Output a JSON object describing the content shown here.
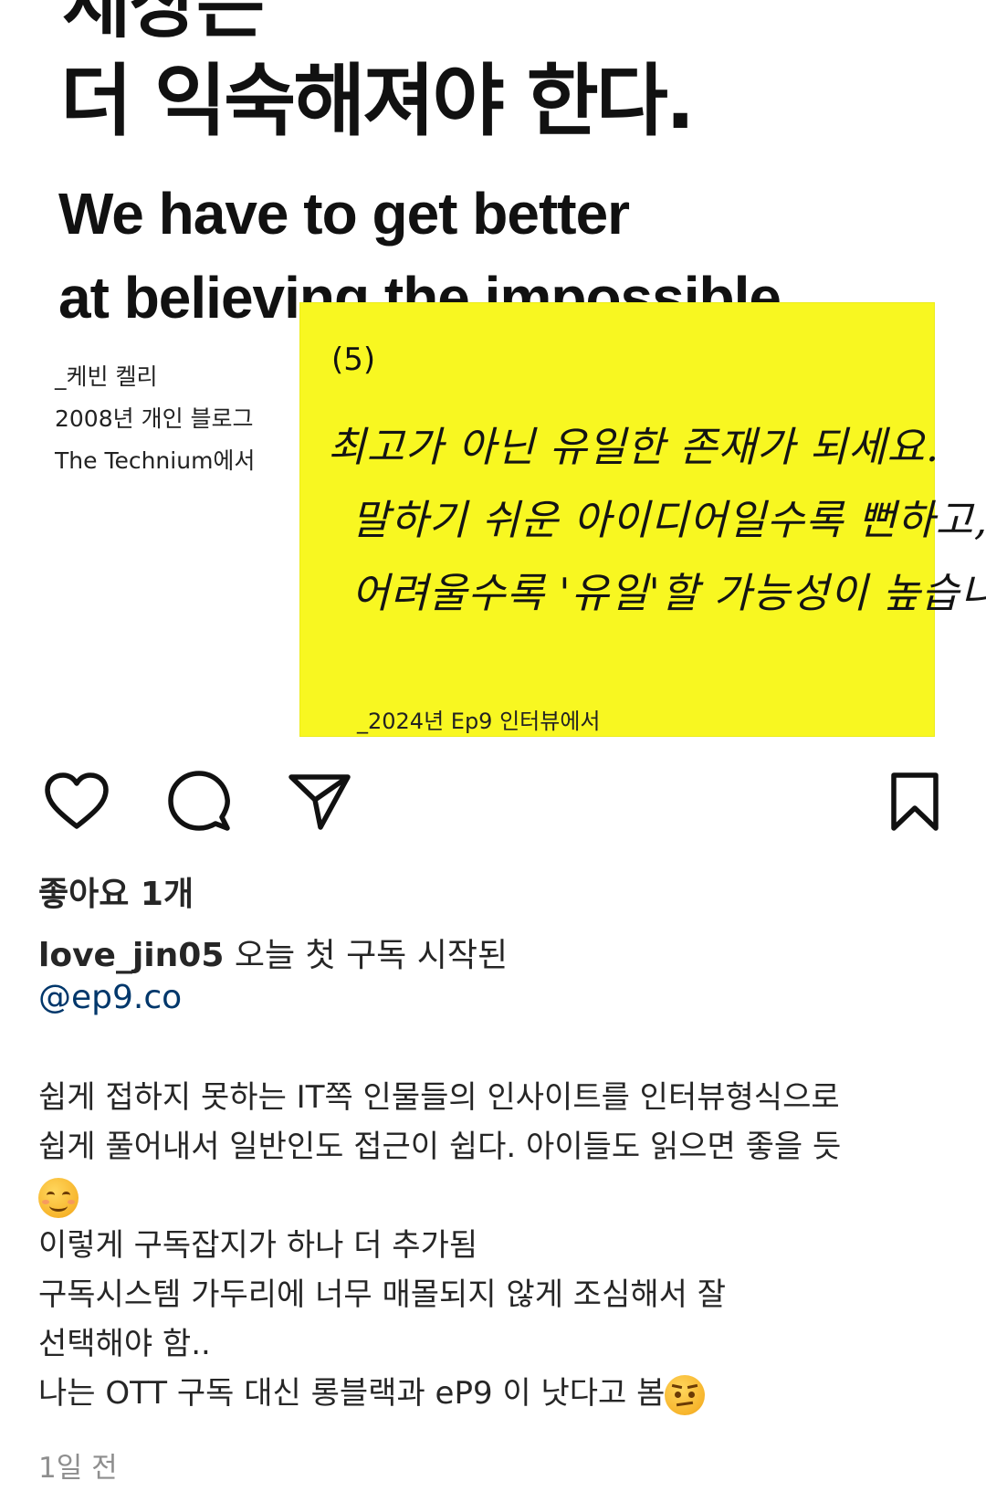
{
  "post_image": {
    "headline_top_cut": "세상은",
    "headline_ko": "더 익숙해져야 한다.",
    "headline_en": [
      "We have to get better",
      "at believing the impossible"
    ],
    "credit": [
      "_케빈 켈리",
      "2008년 개인 블로그",
      "The Technium에서"
    ],
    "note": {
      "number": "(5)",
      "handwriting": [
        "최고가 아닌 유일한 존재가 되세요.",
        "말하기 쉬운 아이디어일수록 뻔하고,",
        "어려울수록 '유일'할 가능성이 높습니다."
      ],
      "source": "_2024년 Ep9 인터뷰에서",
      "color": "#f8f721"
    }
  },
  "actions": {
    "like_icon": "heart-icon",
    "comment_icon": "comment-bubble-icon",
    "share_icon": "paper-plane-icon",
    "save_icon": "bookmark-icon"
  },
  "likes": {
    "text": "좋아요 1개"
  },
  "caption": {
    "username": "love_jin05",
    "headline": " 오늘 첫 구독 시작된",
    "mention": "@ep9.co",
    "lines": [
      "쉽게 접하지 못하는 IT쪽 인물들의 인사이트를 인터뷰형식으로",
      "쉽게 풀어내서 일반인도 접근이 쉽다. 아이들도 읽으면 좋을 듯",
      "",
      "이렇게 구독잡지가 하나 더 추가됨",
      "구독시스템 가두리에 너무 매몰되지 않게 조심해서 잘",
      "선택해야 함..",
      "나는 OTT 구독 대신 롱블랙과 eP9 이 낫다고 봄"
    ],
    "emojis": {
      "after_line_2": "smiling-face-emoji",
      "end_of_line_7": "smirking-face-emoji"
    },
    "mention_color": "#00376b"
  },
  "timestamp": "1일 전"
}
